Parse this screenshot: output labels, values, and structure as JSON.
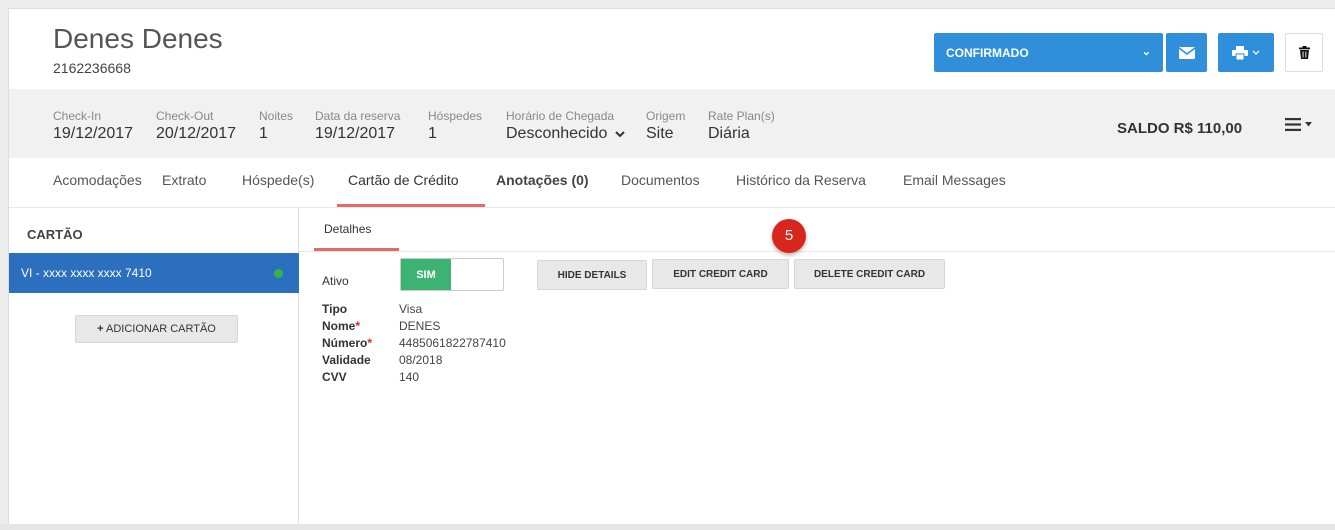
{
  "guest": {
    "name": "Denes Denes",
    "phone": "2162236668"
  },
  "header_actions": {
    "status_label": "CONFIRMADO",
    "status_chevron": "⌄",
    "mail_icon": "envelope-icon",
    "print_icon": "printer-icon",
    "trash_icon": "trash-icon"
  },
  "info": {
    "checkin": {
      "label": "Check-In",
      "value": "19/12/2017"
    },
    "checkout": {
      "label": "Check-Out",
      "value": "20/12/2017"
    },
    "noites": {
      "label": "Noites",
      "value": "1"
    },
    "data_reserva": {
      "label": "Data da reserva",
      "value": "19/12/2017"
    },
    "hospedes": {
      "label": "Hóspedes",
      "value": "1"
    },
    "chegada": {
      "label": "Horário de Chegada",
      "value": "Desconhecido"
    },
    "origem": {
      "label": "Origem",
      "value": "Site"
    },
    "rate_plan": {
      "label": "Rate Plan(s)",
      "value": "Diária"
    },
    "saldo": "SALDO R$ 110,00"
  },
  "tabs": [
    {
      "label": "Acomodações"
    },
    {
      "label": "Extrato"
    },
    {
      "label": "Hóspede(s)"
    },
    {
      "label": "Cartão de Crédito"
    },
    {
      "label": "Anotações (0)"
    },
    {
      "label": "Documentos"
    },
    {
      "label": "Histórico da Reserva"
    },
    {
      "label": "Email Messages"
    }
  ],
  "left_panel": {
    "title": "CARTÃO",
    "card": "VI - xxxx xxxx xxxx 7410",
    "add_button": "ADICIONAR CARTÃO",
    "add_icon": "+"
  },
  "details": {
    "subtab": "Detalhes",
    "ativo_label": "Ativo",
    "toggle_on": "SIM",
    "hide_details": "HIDE DETAILS",
    "edit_card": "EDIT CREDIT CARD",
    "delete_card": "DELETE CREDIT CARD",
    "step_badge": "5",
    "rows": [
      {
        "key": "Tipo",
        "required": "",
        "value": "Visa"
      },
      {
        "key": "Nome",
        "required": "*",
        "value": "DENES"
      },
      {
        "key": "Número",
        "required": "*",
        "value": "4485061822787410"
      },
      {
        "key": "Validade",
        "required": "",
        "value": "08/2018"
      },
      {
        "key": "CVV",
        "required": "",
        "value": "140"
      }
    ]
  },
  "colors": {
    "primary_blue": "#2f8fdb",
    "selected_card": "#2c6fbf",
    "toggle_green": "#3cb371",
    "active_tab_underline": "#e26a6a",
    "badge_red": "#d9261c"
  }
}
